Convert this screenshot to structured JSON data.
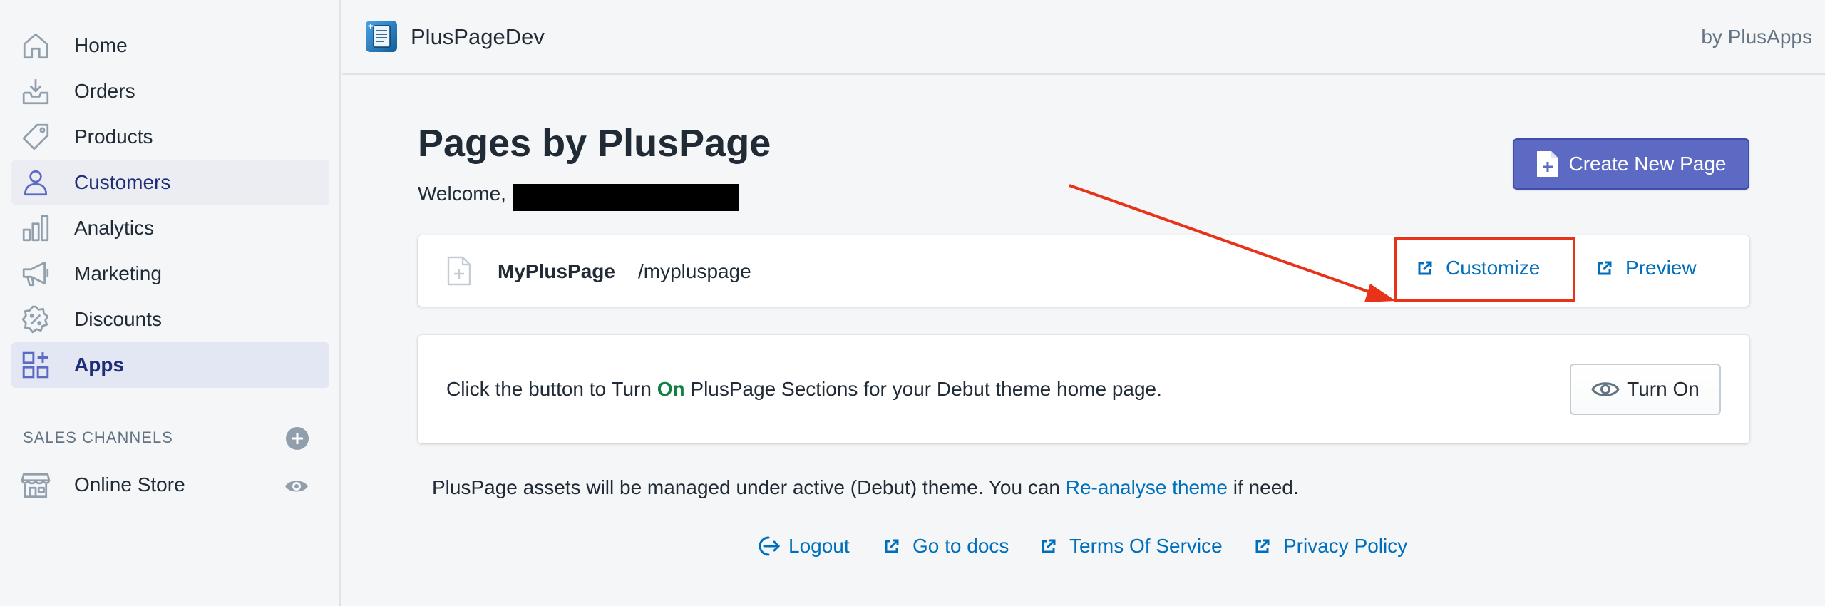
{
  "sidebar": {
    "items": [
      {
        "label": "Home",
        "icon": "home-icon"
      },
      {
        "label": "Orders",
        "icon": "orders-icon"
      },
      {
        "label": "Products",
        "icon": "tag-icon"
      },
      {
        "label": "Customers",
        "icon": "person-icon"
      },
      {
        "label": "Analytics",
        "icon": "bar-chart-icon"
      },
      {
        "label": "Marketing",
        "icon": "megaphone-icon"
      },
      {
        "label": "Discounts",
        "icon": "discount-icon"
      },
      {
        "label": "Apps",
        "icon": "apps-icon"
      }
    ],
    "sales_channels_header": "SALES CHANNELS",
    "online_store_label": "Online Store"
  },
  "topbar": {
    "app_name": "PlusPageDev",
    "byline": "by PlusApps"
  },
  "main": {
    "title": "Pages by PlusPage",
    "welcome": "Welcome,",
    "create_button": "Create New Page",
    "page_row": {
      "name": "MyPlusPage",
      "slug": "/mypluspage",
      "customize": "Customize",
      "preview": "Preview"
    },
    "turnon": {
      "text_before": "Click the button to Turn ",
      "on_word": "On",
      "text_after": " PlusPage Sections for your Debut theme home page.",
      "button": "Turn On"
    },
    "assets_note": {
      "text_before": "PlusPage assets will be managed under active (Debut) theme. You can ",
      "link": "Re-analyse theme",
      "text_after": " if need."
    }
  },
  "footer": {
    "logout": "Logout",
    "docs": "Go to docs",
    "terms": "Terms Of Service",
    "privacy": "Privacy Policy"
  },
  "colors": {
    "accent": "#5c6ac4",
    "link": "#006fbb",
    "on_green": "#108043",
    "annotation_red": "#e8321a"
  }
}
